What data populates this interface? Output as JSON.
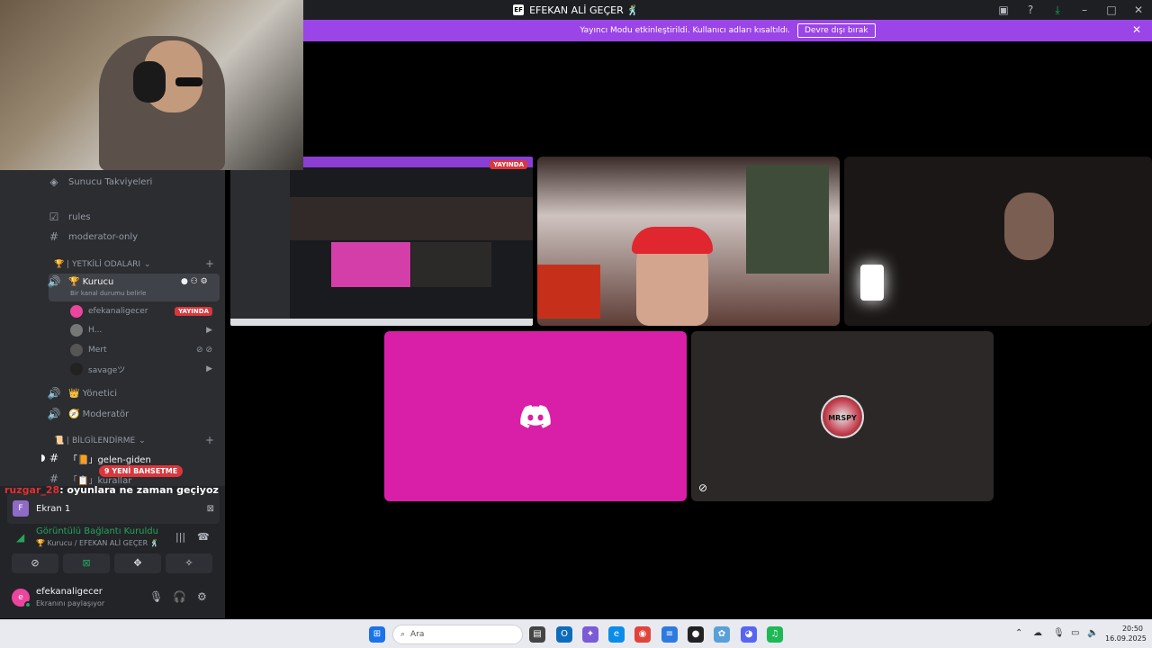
{
  "titlebar": {
    "title": "EFEKAN ALİ GEÇER 🕺",
    "icons": [
      "screen-share-icon",
      "help-icon",
      "download-icon",
      "minimize-icon",
      "maximize-icon",
      "close-icon"
    ]
  },
  "banner": {
    "text": "Yayıncı Modu etkinleştirildi. Kullanıcı adları kısaltıldı.",
    "button": "Devre dışı bırak"
  },
  "sidebar": {
    "boost": "Sunucu Takviyeleri",
    "channels": [
      "rules",
      "moderator-only"
    ],
    "category1": "🏆 | YETKİLİ ODALARI",
    "voice_channel": "🏆 Kurucu",
    "voice_status": "Bir kanal durumu belirle",
    "members": [
      {
        "name": "efekanaligecer",
        "badge": "YAYINDA"
      },
      {
        "name": "H..."
      },
      {
        "name": "Mert"
      },
      {
        "name": "savageツ"
      }
    ],
    "voice_channels": [
      "👑 Yönetici",
      "🧭 Moderatör"
    ],
    "category2": "📜 | BİLGİLENDİRME",
    "channels2": [
      "「📙」gelen-giden",
      "「📋」kurallar"
    ],
    "mention_pill": "9 YENİ BAHSETME"
  },
  "chat_overlay": {
    "nick": "ruzgar_28",
    "message": ": oyunlara ne zaman geçiyoz"
  },
  "panel": {
    "screen_label": "Ekran 1",
    "screen_initial": "F",
    "connection": "Görüntülü Bağlantı Kuruldu",
    "connection_sub": "🏆 Kurucu / EFEKAN ALİ GEÇER 🕺",
    "username": "efekanaligecer",
    "user_status": "Ekranını paylaşıyor",
    "user_initial": "e"
  },
  "stage": {
    "live_badge": "YAYINDA",
    "mrspy_label": "MRSPY"
  },
  "taskbar": {
    "search_placeholder": "Ara",
    "time": "20:50",
    "date": "16.09.2025"
  },
  "colors": {
    "banner": "#9b44e8",
    "live": "#da373c",
    "pink_tile": "#d91fa8",
    "connected": "#23a55a"
  }
}
